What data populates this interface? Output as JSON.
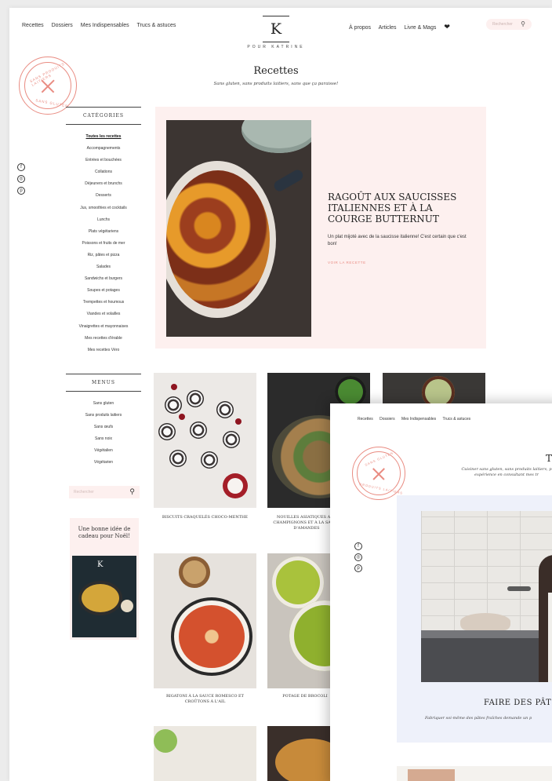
{
  "back_page": {
    "nav_left": [
      "Recettes",
      "Dossiers",
      "Mes Indispensables",
      "Trucs & astuces"
    ],
    "nav_right": [
      "À propos",
      "Articles",
      "Livre & Mags"
    ],
    "heart_icon": "heart-icon",
    "search_placeholder": "Rechercher",
    "logo_letter": "K",
    "logo_sub": "POUR KATRINE",
    "stamp_text": [
      "SANS PRODUITS LAITIERS",
      "SANS GLUTEN"
    ],
    "title": "Recettes",
    "subtitle": "Sans gluten, sans produits laitiers, sans que ça paraisse!",
    "social_icons": [
      "facebook-icon",
      "instagram-icon",
      "pinterest-icon"
    ],
    "social_glyphs": [
      "f",
      "◎",
      "p"
    ],
    "categories_heading": "CATÉGORIES",
    "categories": [
      "Toutes les recettes",
      "Accompagnements",
      "Entrées et bouchées",
      "Collations",
      "Déjeuners et brunchs",
      "Desserts",
      "Jus, smoothies et cocktails",
      "Lunchs",
      "Plats végétariens",
      "Poissons et fruits de mer",
      "Riz, pâtes et pizza",
      "Salades",
      "Sandwichs et burgers",
      "Soupes et potages",
      "Trempettes et houmous",
      "Viandes et volailles",
      "Vinaigrettes et mayonnaises",
      "Mes recettes d'érable",
      "Mes recettes Véro"
    ],
    "menus_heading": "MENUS",
    "menus": [
      "Sans gluten",
      "Sans produits laitiers",
      "Sans œufs",
      "Sans noix",
      "Végétalien",
      "Végétarien"
    ],
    "side_search_placeholder": "Rechercher",
    "gift_title": "Une bonne idée de cadeau pour Noël!",
    "gift_book_letter": "K",
    "hero": {
      "title": "RAGOÛT AUX SAUCISSES ITALIENNES ET À LA COURGE BUTTERNUT",
      "description": "Un plat mijoté avec de la saucisse italienne! C'est certain que c'est bon!",
      "link": "VOIR LA RECETTE"
    },
    "recipes": [
      "BISCUITS CRAQUELÉS CHOCO-MENTHE",
      "NOUILLES ASIATIQUES AUX CHAMPIGNONS ET À LA SAUCE D'AMANDES",
      "RIGATONI À LA SAUCE ROMESCO ET CROÛTONS À L'AIL",
      "POTAGE DE BROCOLI"
    ]
  },
  "front_page": {
    "nav": [
      "Recettes",
      "Dossiers",
      "Mes Indispensables",
      "Trucs & astuces"
    ],
    "stamp_text": [
      "SANS GLUTEN",
      "PRODUITS LAITIERS"
    ],
    "title_fragment": "T",
    "subtitle": "Cuisiner sans gluten, sans produits laitiers, p\nexpérience en consultant mes tr",
    "social_icons": [
      "facebook-icon",
      "instagram-icon",
      "pinterest-icon"
    ],
    "social_glyphs": [
      "f",
      "◎",
      "p"
    ],
    "feature_title": "FAIRE DES PÂT",
    "feature_desc": "Fabriquer soi-même des pâtes fraîches demande un p"
  },
  "colors": {
    "accent": "#e98c82",
    "hero_bg": "#fdf0ef",
    "feature_bg": "#eef1fa"
  }
}
